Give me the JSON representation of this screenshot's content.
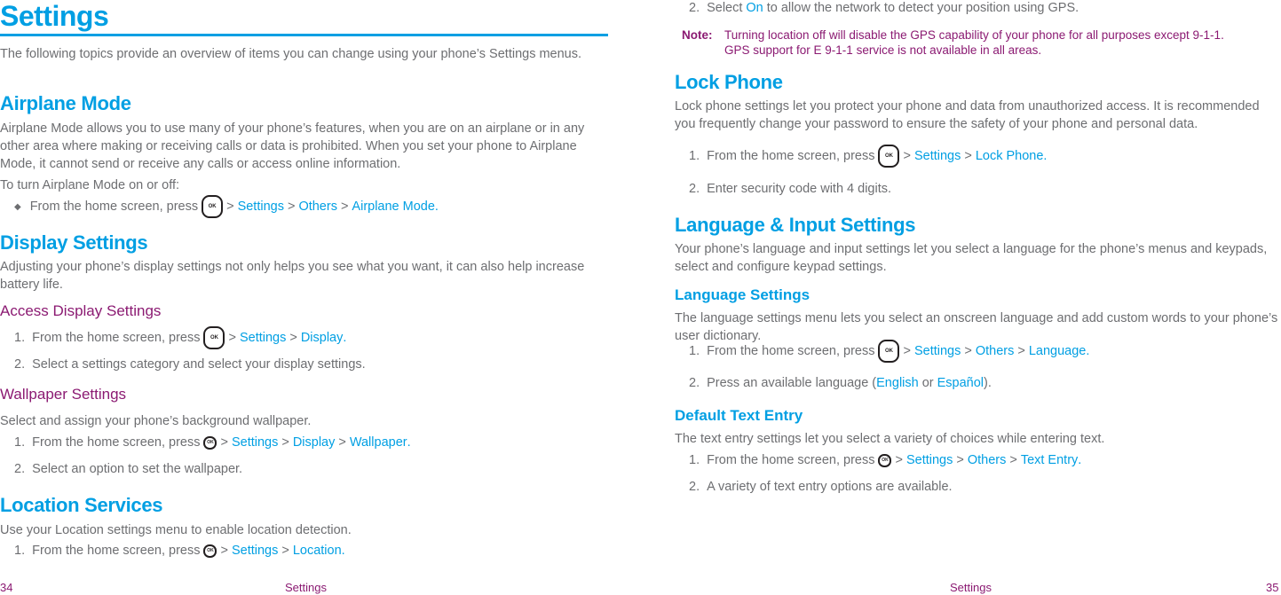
{
  "left_page": {
    "title": "Settings",
    "intro": "The following topics provide an overview of items you can change using your phone’s  Settings menus.",
    "airplane": {
      "heading": "Airplane Mode",
      "body": "Airplane Mode allows you to use many of your phone’s features, when you are on an airplane or in any other area where making or receiving calls or data is prohibited. When you set your phone to Airplane Mode, it cannot send or receive any calls or access online information.",
      "lead": "To turn Airplane Mode on or off:",
      "bullet": "◆",
      "step_text": "From the home screen, press",
      "path": [
        "Settings",
        "Others",
        "Airplane Mode"
      ]
    },
    "display": {
      "heading": "Display Settings",
      "body": "Adjusting your phone’s display settings not only helps you see what you want, it can also help increase battery life.",
      "access": {
        "heading": "Access Display Settings",
        "step1_num": "1.",
        "step1_text": "From the home screen, press",
        "step1_path": [
          "Settings",
          "Display"
        ],
        "step2_num": "2.",
        "step2_text": "Select a settings category and select your display settings."
      },
      "wallpaper": {
        "heading": "Wallpaper Settings",
        "body": "Select and assign your phone’s background wallpaper.",
        "step1_num": "1.",
        "step1_text": "From the home screen, press",
        "step1_path": [
          "Settings",
          "Display",
          "Wallpaper"
        ],
        "step2_num": "2.",
        "step2_text": "Select an option to set the wallpaper."
      }
    },
    "location": {
      "heading": "Location Services",
      "body": "Use your Location settings menu to enable location detection.",
      "step1_num": "1.",
      "step1_text": "From the home screen, press",
      "step1_path": [
        "Settings",
        "Location"
      ]
    },
    "footer": {
      "page_number": "34",
      "section": "Settings"
    }
  },
  "right_page": {
    "location_cont": {
      "step2_num": "2.",
      "step2_pre": "Select",
      "step2_link": "On",
      "step2_post": "to allow the network to detect your position using GPS.",
      "note_label": "Note:",
      "note_line1": "Turning location off will disable the GPS capability of your phone for all purposes except 9-1-1.",
      "note_line2": "GPS support for E 9-1-1 service is not available in all areas."
    },
    "lock": {
      "heading": "Lock Phone",
      "body": "Lock phone settings let you protect your phone and data from unauthorized access. It is recommended you frequently change your password to ensure the safety of your phone and personal data.",
      "step1_num": "1.",
      "step1_text": "From the home screen, press",
      "step1_path": [
        "Settings",
        "Lock Phone"
      ],
      "step2_num": "2.",
      "step2_text": "Enter security code with 4 digits."
    },
    "language_input": {
      "heading": "Language & Input Settings",
      "body": "Your phone’s language and input settings let you select a language for the phone’s menus and keypads, select and configure keypad settings.",
      "language": {
        "heading": "Language Settings",
        "body": "The language settings menu lets you select an onscreen language and add custom words to your phone’s user dictionary.",
        "step1_num": "1.",
        "step1_text": "From the home screen, press",
        "step1_path": [
          "Settings",
          "Others",
          "Language"
        ],
        "step2_num": "2.",
        "step2_pre": "Press an available language (",
        "step2_opt1": "English",
        "step2_or": "or",
        "step2_opt2": "Español",
        "step2_post": ")."
      },
      "text_entry": {
        "heading": "Default Text Entry",
        "body": "The text entry settings let you select a variety of choices while entering text.",
        "step1_num": "1.",
        "step1_text": "From the home screen, press",
        "step1_path": [
          "Settings",
          "Others",
          "Text Entry"
        ],
        "step2_num": "2.",
        "step2_text": "A variety of text entry options are available."
      }
    },
    "footer": {
      "section": "Settings",
      "page_number": "35"
    }
  },
  "common": {
    "ok_key_label": "OK",
    "path_separator": ">",
    "period": "."
  },
  "colors": {
    "accent_blue": "#009fe3",
    "accent_purple": "#8b1a72",
    "body_gray": "#6d6e71"
  }
}
